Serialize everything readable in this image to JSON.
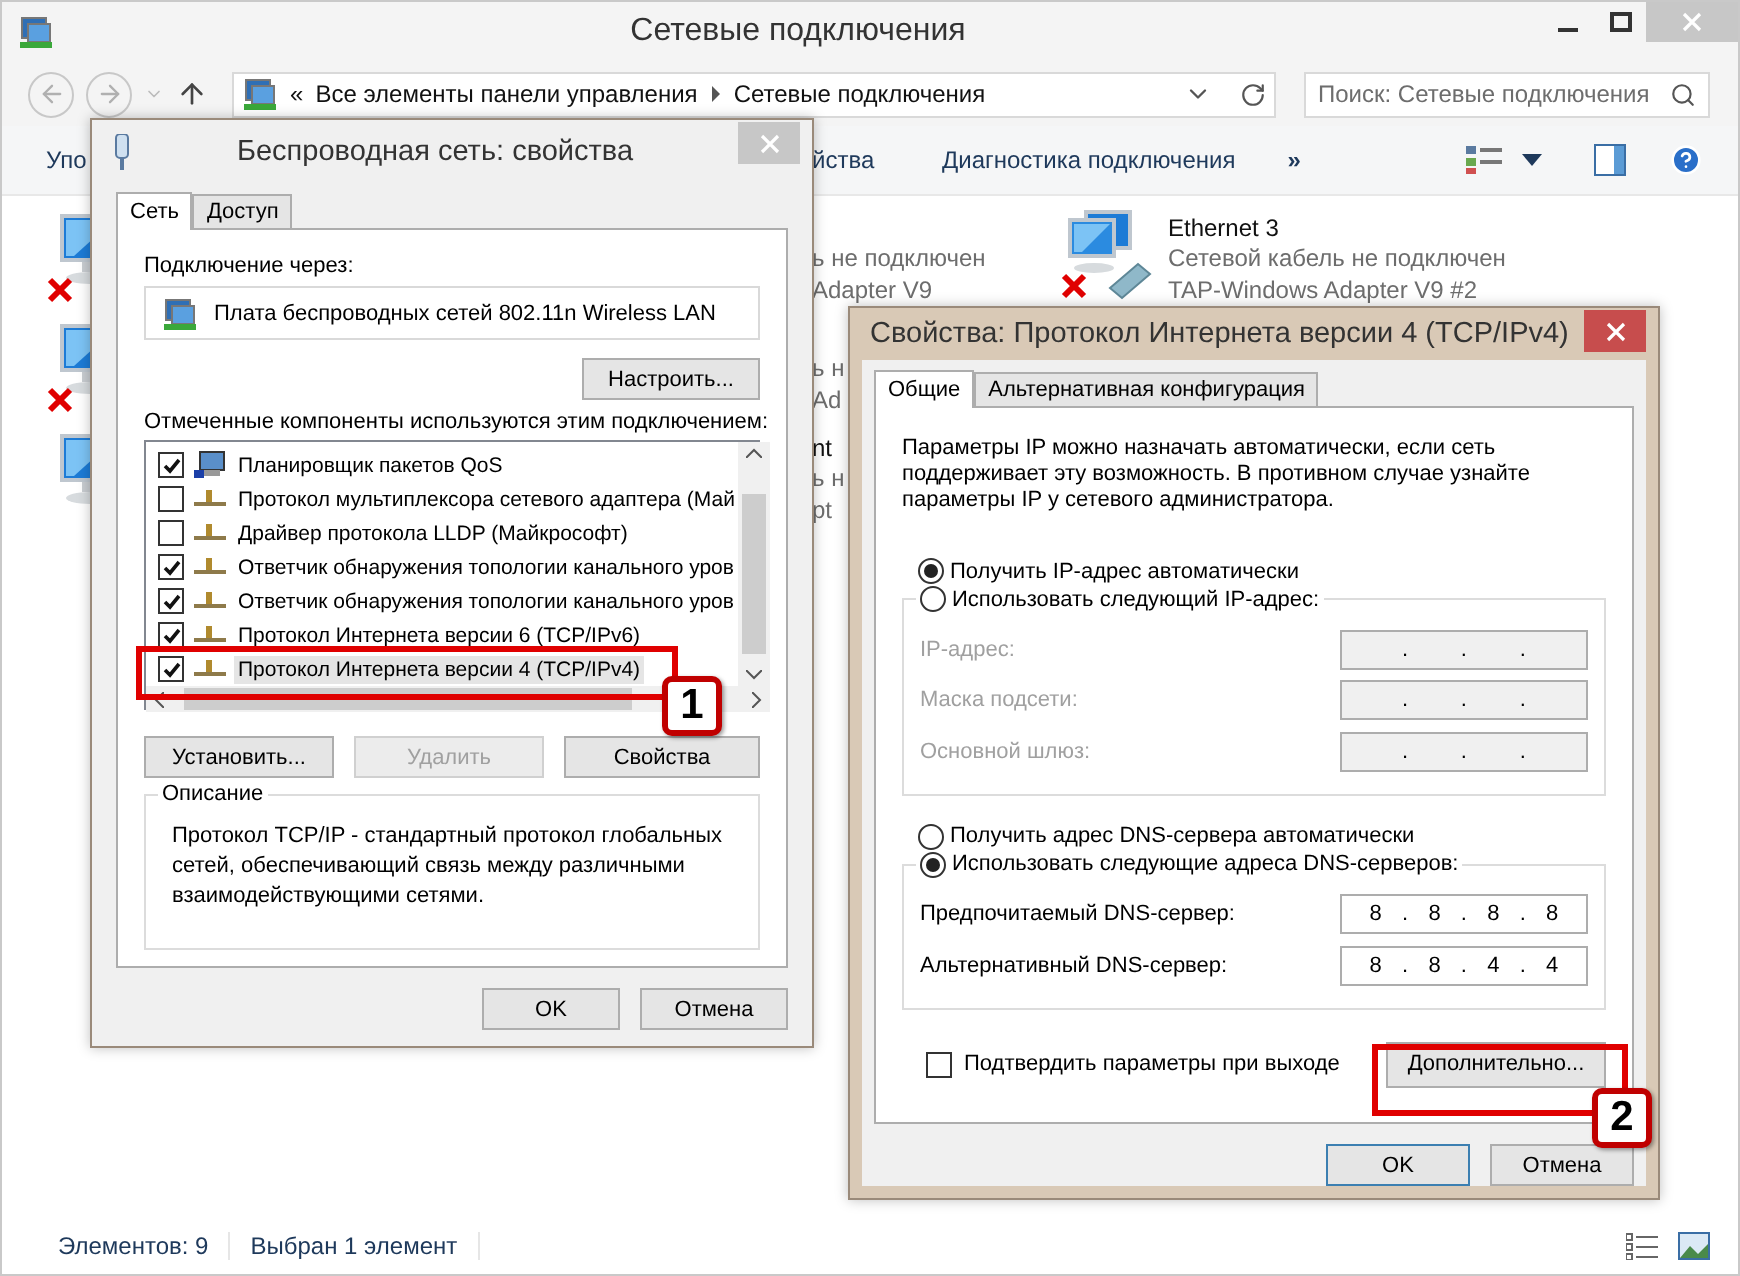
{
  "window": {
    "title": "Сетевые подключения"
  },
  "address_bar": {
    "overflow": "«",
    "crumbs": [
      "Все элементы панели управления",
      "Сетевые подключения"
    ]
  },
  "search": {
    "placeholder": "Поиск: Сетевые подключения"
  },
  "command_bar": {
    "items": [
      "Упо",
      "йства",
      "Диагностика подключения"
    ],
    "more": "»"
  },
  "connections": [
    {
      "kind": "cut",
      "disconnected": true,
      "lines": [
        "ь не подключен",
        "Adapter V9"
      ]
    },
    {
      "kind": "cut",
      "disconnected": true,
      "lines": [
        "ь н",
        "Ad"
      ]
    },
    {
      "kind": "cut",
      "disconnected": false,
      "lines": [
        "nt",
        "ь н",
        "pt"
      ]
    },
    {
      "kind": "full",
      "disconnected": true,
      "lines": [
        "Ethernet 3",
        "Сетевой кабель не подключен",
        "TAP-Windows Adapter V9 #2"
      ]
    }
  ],
  "status_bar": [
    "Элементов: 9",
    "Выбран 1 элемент"
  ],
  "wireless_dialog": {
    "title": "Беспроводная сеть: свойства",
    "tabs": [
      {
        "label": "Сеть",
        "selected": true
      },
      {
        "label": "Доступ",
        "selected": false
      }
    ],
    "connect_label": "Подключение через:",
    "adapter": "Плата беспроводных сетей 802.11n Wireless LAN",
    "configure_button": "Настроить...",
    "components_label": "Отмеченные компоненты используются этим подключением:",
    "components": [
      {
        "label": "Планировщик пакетов QoS",
        "kind": "service",
        "checked": true,
        "selected": false
      },
      {
        "label": "Протокол мультиплексора сетевого адаптера (Май",
        "kind": "protocol",
        "checked": false,
        "selected": false
      },
      {
        "label": "Драйвер протокола LLDP (Майкрософт)",
        "kind": "protocol",
        "checked": false,
        "selected": false
      },
      {
        "label": "Ответчик обнаружения топологии канального уров",
        "kind": "protocol",
        "checked": true,
        "selected": false
      },
      {
        "label": "Ответчик обнаружения топологии канального уров",
        "kind": "protocol",
        "checked": true,
        "selected": false
      },
      {
        "label": "Протокол Интернета версии 6 (TCP/IPv6)",
        "kind": "protocol",
        "checked": true,
        "selected": false
      },
      {
        "label": "Протокол Интернета версии 4 (TCP/IPv4)",
        "kind": "protocol",
        "checked": true,
        "selected": true
      }
    ],
    "buttons": [
      {
        "label": "Установить...",
        "disabled": false
      },
      {
        "label": "Удалить",
        "disabled": true
      },
      {
        "label": "Свойства",
        "disabled": false
      }
    ],
    "description": {
      "title": "Описание",
      "text": "Протокол TCP/IP - стандартный протокол глобальных сетей, обеспечивающий связь между различными взаимодействующими сетями."
    },
    "footer_buttons": [
      "OK",
      "Отмена"
    ]
  },
  "ipv4_dialog": {
    "title": "Свойства: Протокол Интернета версии 4 (TCP/IPv4)",
    "tabs": [
      {
        "label": "Общие",
        "selected": true
      },
      {
        "label": "Альтернативная конфигурация",
        "selected": false
      }
    ],
    "intro": "Параметры IP можно назначать автоматически, если сеть поддерживает эту возможность. В противном случае узнайте параметры IP у сетевого администратора.",
    "ip_mode": [
      {
        "label": "Получить IP-адрес автоматически",
        "selected": true
      },
      {
        "label": "Использовать следующий IP-адрес:",
        "selected": false
      }
    ],
    "ip_fields": [
      {
        "label": "IP-адрес:",
        "disabled": true
      },
      {
        "label": "Маска подсети:",
        "disabled": true
      },
      {
        "label": "Основной шлюз:",
        "disabled": true
      }
    ],
    "separator": ".",
    "dns_mode": [
      {
        "label": "Получить адрес DNS-сервера автоматически",
        "selected": false
      },
      {
        "label": "Использовать следующие адреса DNS-серверов:",
        "selected": true
      }
    ],
    "dns_fields": [
      {
        "label": "Предпочитаемый DNS-сервер:",
        "octets": [
          "8",
          "8",
          "8",
          "8"
        ],
        "disabled": false
      },
      {
        "label": "Альтернативный DNS-сервер:",
        "octets": [
          "8",
          "8",
          "4",
          "4"
        ],
        "disabled": false
      }
    ],
    "validate": {
      "label": "Подтвердить параметры при выходе",
      "checked": false
    },
    "advanced_button": "Дополнительно...",
    "footer_buttons": [
      "OK",
      "Отмена"
    ]
  },
  "annotations": [
    "1",
    "2"
  ]
}
